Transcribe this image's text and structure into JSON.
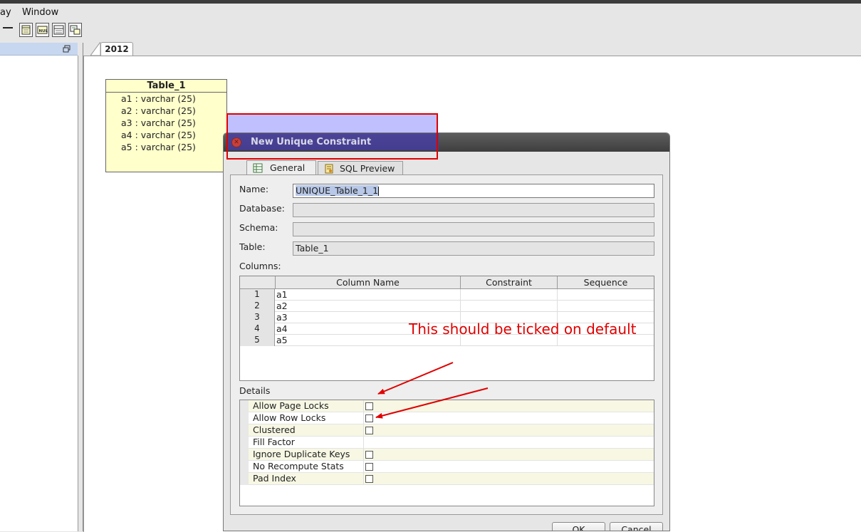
{
  "menu": {
    "items": [
      "ay",
      "Window"
    ]
  },
  "editor_tab": {
    "label": "2012"
  },
  "table_box": {
    "title": "Table_1",
    "columns": [
      "a1 : varchar (25)",
      "a2 : varchar (25)",
      "a3 : varchar (25)",
      "a4 : varchar (25)",
      "a5 : varchar (25)"
    ]
  },
  "dialog": {
    "title": "New Unique Constraint",
    "tabs": [
      "General",
      "SQL Preview"
    ],
    "form": {
      "name_label": "Name:",
      "name_value": "UNIQUE_Table_1_1",
      "database_label": "Database:",
      "database_value": "",
      "schema_label": "Schema:",
      "schema_value": "",
      "table_label": "Table:",
      "table_value": "Table_1",
      "columns_label": "Columns:"
    },
    "columns_grid": {
      "headers": [
        "Column Name",
        "Constraint",
        "Sequence"
      ],
      "rows": [
        {
          "num": "1",
          "name": "a1",
          "constraint": "",
          "sequence": ""
        },
        {
          "num": "2",
          "name": "a2",
          "constraint": "",
          "sequence": ""
        },
        {
          "num": "3",
          "name": "a3",
          "constraint": "",
          "sequence": ""
        },
        {
          "num": "4",
          "name": "a4",
          "constraint": "",
          "sequence": ""
        },
        {
          "num": "5",
          "name": "a5",
          "constraint": "",
          "sequence": ""
        }
      ]
    },
    "details_label": "Details",
    "details": [
      {
        "label": "Allow Page Locks",
        "checkbox": true,
        "checked": false
      },
      {
        "label": "Allow Row Locks",
        "checkbox": true,
        "checked": false
      },
      {
        "label": "Clustered",
        "checkbox": true,
        "checked": false
      },
      {
        "label": "Fill Factor",
        "checkbox": false,
        "value": ""
      },
      {
        "label": "Ignore Duplicate Keys",
        "checkbox": true,
        "checked": false
      },
      {
        "label": "No Recompute Stats",
        "checkbox": true,
        "checked": false
      },
      {
        "label": "Pad Index",
        "checkbox": true,
        "checked": false
      }
    ],
    "buttons": {
      "ok": "OK",
      "cancel": "Cancel"
    }
  },
  "annotation": {
    "text": "This should be ticked on default",
    "color": "#e00000"
  },
  "icons": {
    "toolbar": [
      "minimize-bar-icon",
      "table-icon",
      "null-icon",
      "form-icon",
      "view-icon"
    ],
    "panel_restore": "restore-window-icon",
    "dialog_close": "close-icon",
    "tab_general": "grid-icon",
    "tab_sql": "sql-script-icon"
  }
}
